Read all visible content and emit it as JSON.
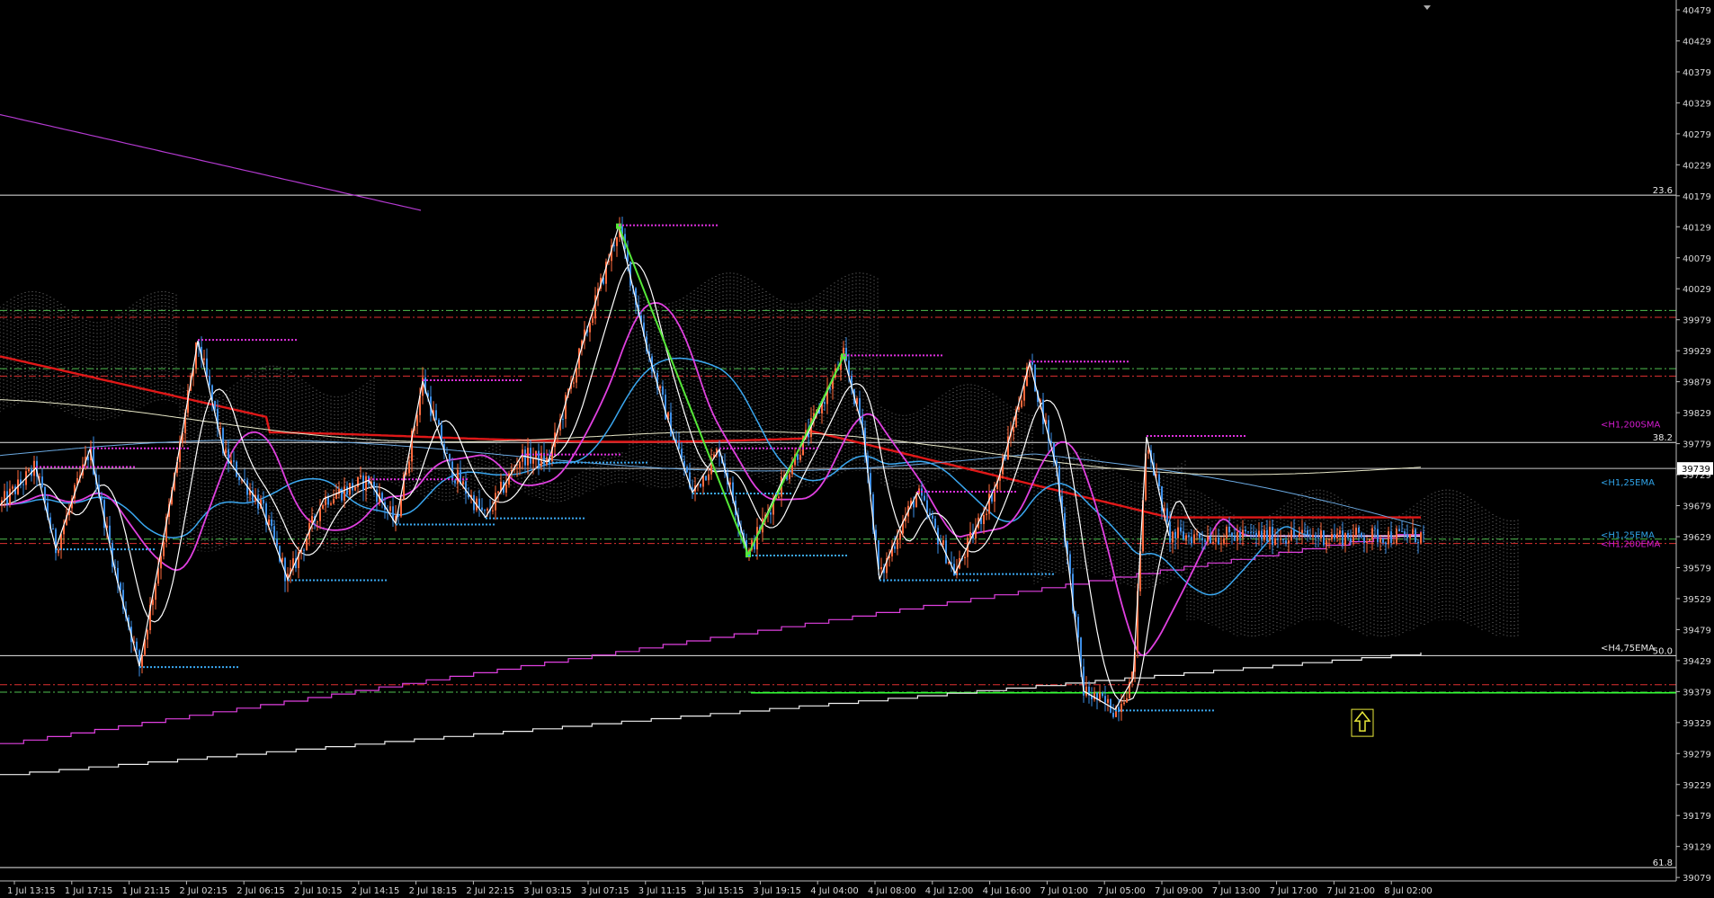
{
  "chart_data": {
    "type": "candlestick",
    "x_ticks": [
      "1 Jul 13:15",
      "1 Jul 17:15",
      "1 Jul 21:15",
      "2 Jul 02:15",
      "2 Jul 06:15",
      "2 Jul 10:15",
      "2 Jul 14:15",
      "2 Jul 18:15",
      "2 Jul 22:15",
      "3 Jul 03:15",
      "3 Jul 07:15",
      "3 Jul 11:15",
      "3 Jul 15:15",
      "3 Jul 19:15",
      "4 Jul 04:00",
      "4 Jul 08:00",
      "4 Jul 12:00",
      "4 Jul 16:00",
      "7 Jul 01:00",
      "7 Jul 05:00",
      "7 Jul 09:00",
      "7 Jul 13:00",
      "7 Jul 17:00",
      "7 Jul 21:00",
      "8 Jul 02:00"
    ],
    "y_ticks": [
      "40479",
      "40429",
      "40379",
      "40329",
      "40279",
      "40229",
      "40179",
      "40129",
      "40079",
      "40029",
      "39979",
      "39929",
      "39879",
      "39829",
      "39779",
      "39729",
      "39679",
      "39629",
      "39579",
      "39529",
      "39479",
      "39429",
      "39379",
      "39329",
      "39279",
      "39229",
      "39179",
      "39129",
      "39079"
    ],
    "ylim": [
      39070,
      40485
    ],
    "current_price": "39739",
    "fib_levels": [
      {
        "label": "23.6",
        "price": 40180
      },
      {
        "label": "38.2",
        "price": 39781
      },
      {
        "label": "50.0",
        "price": 39437
      },
      {
        "label": "61.8",
        "price": 39095
      }
    ],
    "indicator_labels": [
      {
        "text": "<H1,200SMA",
        "price": 39805,
        "color": "#d41bd0"
      },
      {
        "text": "<H1,25EMA",
        "price": 39712,
        "color": "#2fa3e8"
      },
      {
        "text": "<H1,25EMA",
        "price": 39627,
        "color": "#2fa3e8"
      },
      {
        "text": "<H1,200EMA",
        "price": 39612,
        "color": "#d41bd0"
      },
      {
        "text": "<H4,75EMA",
        "price": 39445,
        "color": "#e6e6e6"
      }
    ],
    "swing_points": [
      [
        0,
        39680
      ],
      [
        40,
        39740
      ],
      [
        62,
        39610
      ],
      [
        100,
        39770
      ],
      [
        130,
        39560
      ],
      [
        155,
        39420
      ],
      [
        190,
        39690
      ],
      [
        220,
        39945
      ],
      [
        250,
        39760
      ],
      [
        290,
        39680
      ],
      [
        320,
        39560
      ],
      [
        360,
        39690
      ],
      [
        410,
        39720
      ],
      [
        440,
        39650
      ],
      [
        470,
        39880
      ],
      [
        500,
        39740
      ],
      [
        540,
        39660
      ],
      [
        580,
        39760
      ],
      [
        610,
        39750
      ],
      [
        650,
        39950
      ],
      [
        688,
        40130
      ],
      [
        720,
        39930
      ],
      [
        740,
        39830
      ],
      [
        770,
        39700
      ],
      [
        800,
        39770
      ],
      [
        832,
        39600
      ],
      [
        870,
        39720
      ],
      [
        900,
        39800
      ],
      [
        938,
        39920
      ],
      [
        960,
        39800
      ],
      [
        978,
        39560
      ],
      [
        1000,
        39640
      ],
      [
        1020,
        39700
      ],
      [
        1062,
        39570
      ],
      [
        1110,
        39720
      ],
      [
        1145,
        39910
      ],
      [
        1175,
        39740
      ],
      [
        1205,
        39380
      ],
      [
        1240,
        39350
      ],
      [
        1260,
        39400
      ],
      [
        1275,
        39790
      ],
      [
        1300,
        39630
      ]
    ],
    "zigzag_green": [
      [
        688,
        40130
      ],
      [
        832,
        39600
      ],
      [
        938,
        39920
      ]
    ],
    "horizontal_levels": [
      {
        "price": 39994,
        "color": "#4fbf4f",
        "style": "dashdot"
      },
      {
        "price": 39983,
        "color": "#e03030",
        "style": "dashdot"
      },
      {
        "price": 39900,
        "color": "#4fbf4f",
        "style": "dashdot"
      },
      {
        "price": 39888,
        "color": "#e03030",
        "style": "dashdot"
      },
      {
        "price": 39625,
        "color": "#4fbf4f",
        "style": "dashdot"
      },
      {
        "price": 39618,
        "color": "#e03030",
        "style": "dashdot"
      },
      {
        "price": 39390,
        "color": "#e03030",
        "style": "dashdot"
      },
      {
        "price": 39378,
        "color": "#4fbf4f",
        "style": "dashdot"
      }
    ],
    "colors": {
      "background": "#000000",
      "candle_up": "#ff6a3d",
      "candle_down": "#3d8fe8",
      "ema_fast": "#ffffff",
      "ema_mid": "#e040e0",
      "ema_slow": "#3aa7f0",
      "sma_red": "#e01818",
      "support_green": "#33ff33",
      "zigzag": "#ffffff",
      "cloud": "#a0a0a0",
      "arrow": "#e8e83a"
    }
  }
}
